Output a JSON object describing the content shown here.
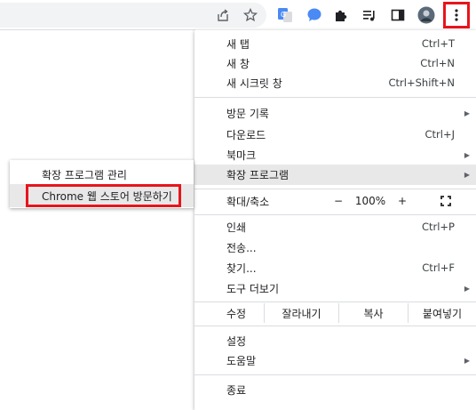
{
  "menu": {
    "new_tab": {
      "label": "새 탭",
      "shortcut": "Ctrl+T"
    },
    "new_window": {
      "label": "새 창",
      "shortcut": "Ctrl+N"
    },
    "new_incognito": {
      "label": "새 시크릿 창",
      "shortcut": "Ctrl+Shift+N"
    },
    "history": {
      "label": "방문 기록"
    },
    "downloads": {
      "label": "다운로드",
      "shortcut": "Ctrl+J"
    },
    "bookmarks": {
      "label": "북마크"
    },
    "extensions": {
      "label": "확장 프로그램"
    },
    "zoom": {
      "label": "확대/축소",
      "minus": "−",
      "value": "100%",
      "plus": "+"
    },
    "print": {
      "label": "인쇄",
      "shortcut": "Ctrl+P"
    },
    "cast": {
      "label": "전송..."
    },
    "find": {
      "label": "찾기...",
      "shortcut": "Ctrl+F"
    },
    "more_tools": {
      "label": "도구 더보기"
    },
    "edit": {
      "label": "수정",
      "cut": "잘라내기",
      "copy": "복사",
      "paste": "붙여넣기"
    },
    "settings": {
      "label": "설정"
    },
    "help": {
      "label": "도움말"
    },
    "exit": {
      "label": "종료"
    }
  },
  "submenu": {
    "manage_extensions": "확장 프로그램 관리",
    "visit_web_store": "Chrome 웹 스토어 방문하기"
  },
  "colors": {
    "highlight": "#e8141c",
    "hover": "#e8e8e8"
  }
}
